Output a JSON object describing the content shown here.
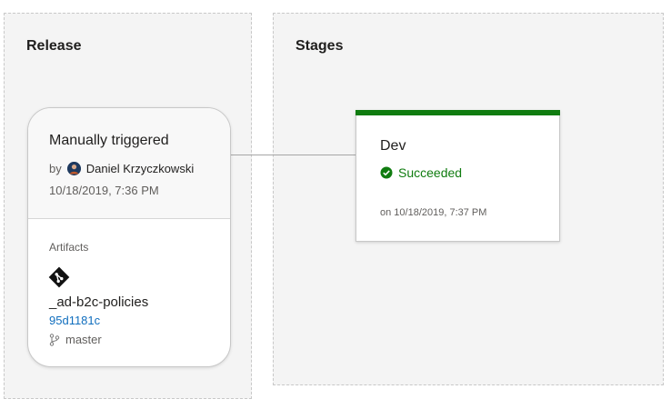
{
  "release": {
    "section_title": "Release",
    "trigger": {
      "title": "Manually triggered",
      "by_label": "by",
      "author": "Daniel Krzyczkowski",
      "date": "10/18/2019, 7:36 PM"
    },
    "artifacts": {
      "label": "Artifacts",
      "icon": "git-icon",
      "name": "_ad-b2c-policies",
      "commit": "95d1181c",
      "branch_icon": "branch-icon",
      "branch": "master"
    }
  },
  "stages": {
    "section_title": "Stages",
    "items": [
      {
        "name": "Dev",
        "status": "Succeeded",
        "status_icon": "check-circle-icon",
        "status_color": "#107c10",
        "date": "on 10/18/2019, 7:37 PM"
      }
    ]
  }
}
